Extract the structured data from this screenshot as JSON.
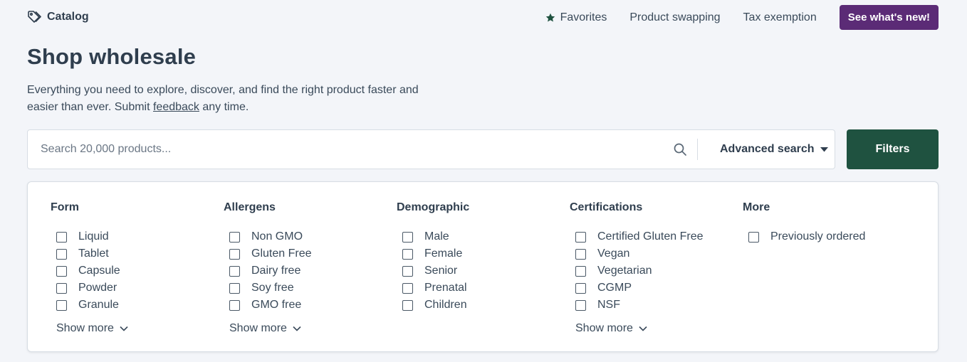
{
  "header": {
    "brand_label": "Catalog",
    "nav": [
      {
        "label": "Favorites"
      },
      {
        "label": "Product swapping"
      },
      {
        "label": "Tax exemption"
      }
    ],
    "cta_label": "See what's new!"
  },
  "page": {
    "title": "Shop wholesale",
    "subtitle_before": "Everything you need to explore, discover, and find the right product faster and easier than ever. Submit ",
    "subtitle_link": "feedback",
    "subtitle_after": " any time."
  },
  "search": {
    "placeholder": "Search 20,000 products...",
    "value": "",
    "advanced_label": "Advanced search",
    "filters_label": "Filters"
  },
  "filters": {
    "form": {
      "title": "Form",
      "options": [
        "Liquid",
        "Tablet",
        "Capsule",
        "Powder",
        "Granule"
      ],
      "show_more": "Show more"
    },
    "allergens": {
      "title": "Allergens",
      "options": [
        "Non GMO",
        "Gluten Free",
        "Dairy free",
        "Soy free",
        "GMO free"
      ],
      "show_more": "Show more"
    },
    "demographic": {
      "title": "Demographic",
      "options": [
        "Male",
        "Female",
        "Senior",
        "Prenatal",
        "Children"
      ]
    },
    "certifications": {
      "title": "Certifications",
      "options": [
        "Certified Gluten Free",
        "Vegan",
        "Vegetarian",
        "CGMP",
        "NSF"
      ],
      "show_more": "Show more"
    },
    "more": {
      "title": "More",
      "options": [
        "Previously ordered"
      ]
    }
  },
  "colors": {
    "accent_purple": "#5b2b76",
    "accent_green": "#1f5240",
    "page_bg": "#f3f5f9"
  },
  "icons": {
    "brand": "tag-icon",
    "favorites": "star-icon",
    "search": "search-icon",
    "dropdown": "caret-down-icon",
    "show_more": "chevron-down-icon"
  }
}
